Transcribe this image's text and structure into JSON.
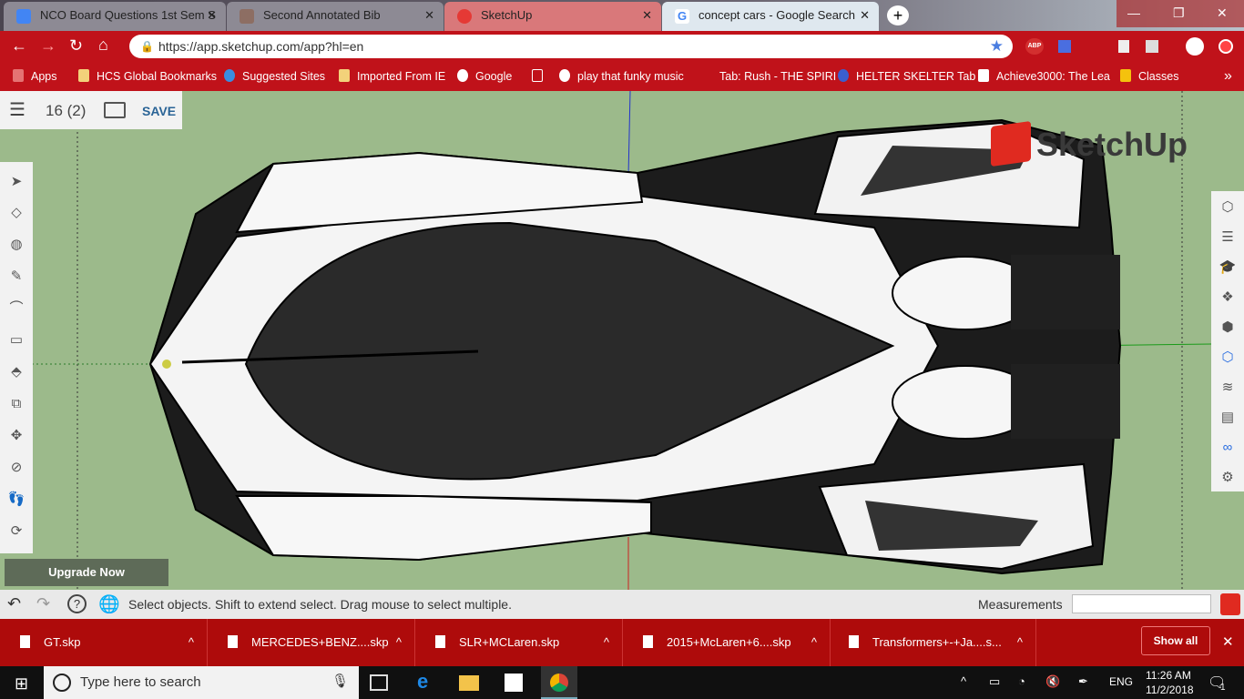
{
  "browser": {
    "tabs": [
      {
        "label": "NCO Board Questions 1st Sem S",
        "icon": "docs-icon",
        "color": "#4285f4"
      },
      {
        "label": "Second Annotated Bib",
        "icon": "person-icon",
        "color": "#8d6e63"
      },
      {
        "label": "SketchUp",
        "icon": "sketchup-icon",
        "color": "#e53935",
        "active": true
      },
      {
        "label": "concept cars - Google Search",
        "icon": "google-icon",
        "color": "#4285f4"
      }
    ],
    "url": "https://app.sketchup.com/app?hl=en",
    "bookmarks": [
      "Apps",
      "HCS Global Bookmarks",
      "Suggested Sites",
      "Imported From IE",
      "Google",
      "",
      "play that funky music",
      "Tab: Rush - THE SPIRI",
      "HELTER SKELTER Tab",
      "Achieve3000: The Lea",
      "Classes"
    ],
    "ext_abp": "ABP",
    "more": "»"
  },
  "sketchup": {
    "model_name": "16 (2)",
    "save": "SAVE",
    "brand": "SketchUp",
    "upgrade": "Upgrade Now",
    "status_text": "Select objects. Shift to extend select. Drag mouse to select multiple.",
    "measurements_label": "Measurements",
    "measurements_value": ""
  },
  "downloads": {
    "items": [
      "GT.skp",
      "MERCEDES+BENZ....skp",
      "SLR+MCLaren.skp",
      "2015+McLaren+6....skp",
      "Transformers+-+Ja....s..."
    ],
    "show_all": "Show all"
  },
  "taskbar": {
    "search_placeholder": "Type here to search",
    "lang": "ENG",
    "time": "11:26 AM",
    "date": "11/2/2018",
    "notifications": "1"
  }
}
